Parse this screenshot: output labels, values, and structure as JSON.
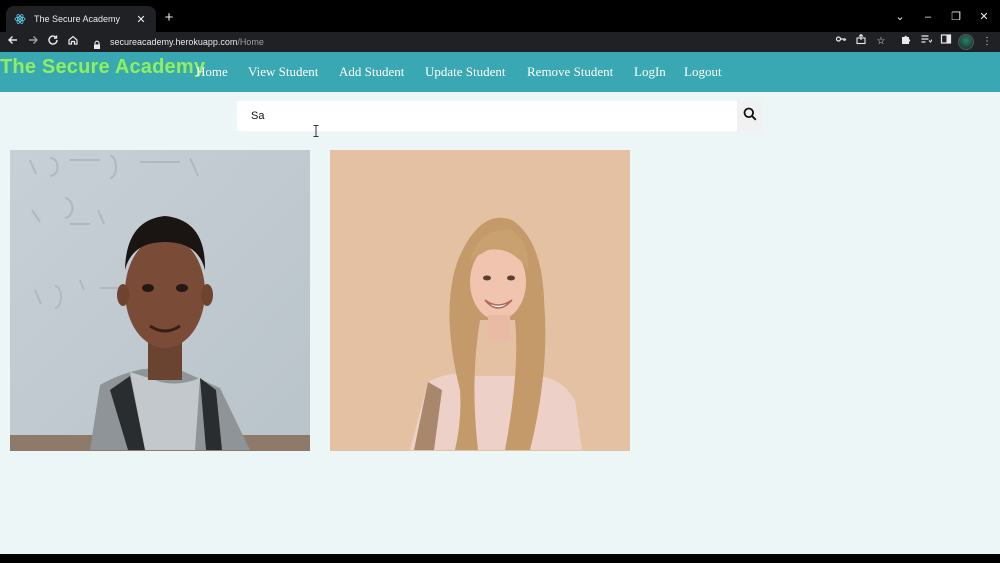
{
  "browser": {
    "tab": {
      "title": "The Secure Academy",
      "favicon": "react-icon"
    },
    "url": {
      "host": "secureacademy.herokuapp.com",
      "path": "/Home"
    }
  },
  "site": {
    "brand": "The Secure Academy",
    "nav": [
      {
        "label": "Home"
      },
      {
        "label": "View Student"
      },
      {
        "label": "Add Student"
      },
      {
        "label": "Update Student"
      },
      {
        "label": "Remove Student"
      },
      {
        "label": "LogIn"
      },
      {
        "label": "Logout"
      }
    ],
    "search": {
      "value": "Sa",
      "icon": "search-icon"
    },
    "results": [
      {
        "name": "student-photo-boy"
      },
      {
        "name": "student-photo-girl"
      }
    ]
  },
  "colors": {
    "navbar": "#3aa8b2",
    "brand": "#8ef05e",
    "page_bg": "#ecf6f7"
  }
}
